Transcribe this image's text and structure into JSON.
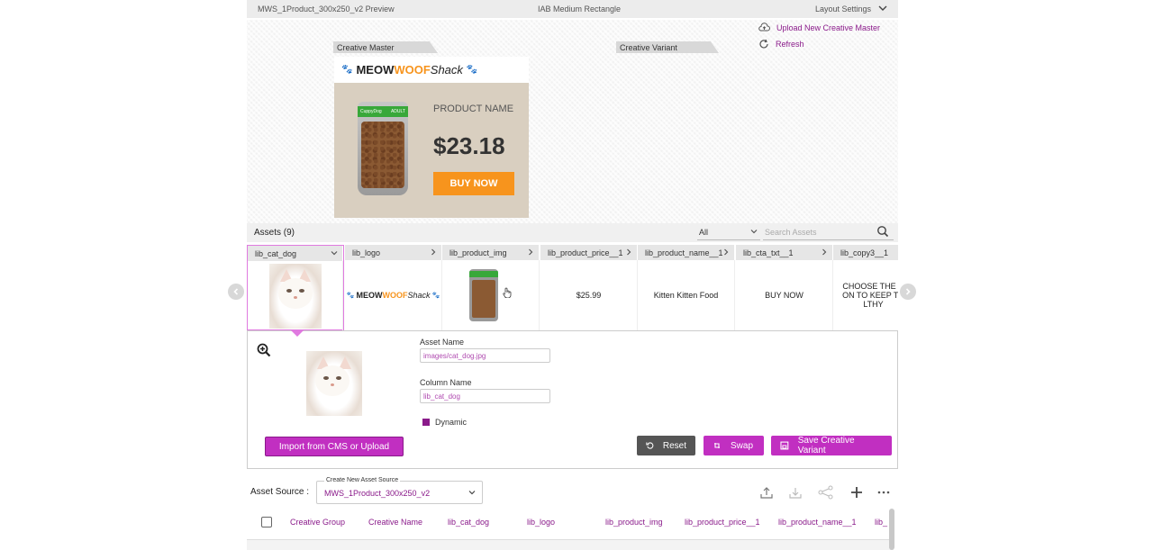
{
  "topbar": {
    "title": "MWS_1Product_300x250_v2 Preview",
    "size_label": "IAB Medium Rectangle",
    "layout_settings": "Layout Settings"
  },
  "preview": {
    "master_tab": "Creative Master",
    "variant_tab": "Creative Variant",
    "upload_link": "Upload New Creative Master",
    "refresh_link": "Refresh",
    "ad": {
      "logo_meow": "MEOW",
      "logo_woof": "WOOF",
      "logo_shack": "Shack",
      "bag_brand": "CuppyDog",
      "bag_adult": "ADULT",
      "product_name": "PRODUCT NAME",
      "price": "$23.18",
      "cta": "BUY NOW"
    }
  },
  "assets": {
    "title": "Assets (9)",
    "filter_value": "All",
    "search_placeholder": "Search Assets",
    "columns": [
      {
        "header": "lib_cat_dog",
        "value": ""
      },
      {
        "header": "lib_logo",
        "value": ""
      },
      {
        "header": "lib_product_img",
        "value": ""
      },
      {
        "header": "lib_product_price__1",
        "value": "$25.99"
      },
      {
        "header": "lib_product_name__1",
        "value": "Kitten Kitten Food"
      },
      {
        "header": "lib_cta_txt__1",
        "value": "BUY NOW"
      },
      {
        "header": "lib_copy3__1",
        "value": "CHOOSE THE N ON TO KEEP TH LTHY"
      }
    ]
  },
  "detail": {
    "asset_name_label": "Asset Name",
    "asset_name_value": "images/cat_dog.jpg",
    "column_name_label": "Column Name",
    "column_name_value": "lib_cat_dog",
    "dynamic_label": "Dynamic",
    "import_button": "Import from CMS or Upload",
    "reset_button": "Reset",
    "swap_button": "Swap",
    "save_button": "Save Creative Variant"
  },
  "source": {
    "label": "Asset Source :",
    "float_label": "Create New Asset Source",
    "value": "MWS_1Product_300x250_v2"
  },
  "table": {
    "headers": [
      "Creative Group",
      "Creative Name",
      "lib_cat_dog",
      "lib_logo",
      "lib_product_img",
      "lib_product_price__1",
      "lib_product_name__1",
      "lib_"
    ]
  },
  "colors": {
    "accent": "#c12fc1",
    "accent_dark": "#8a1a8a",
    "brand_orange": "#f7941d"
  }
}
